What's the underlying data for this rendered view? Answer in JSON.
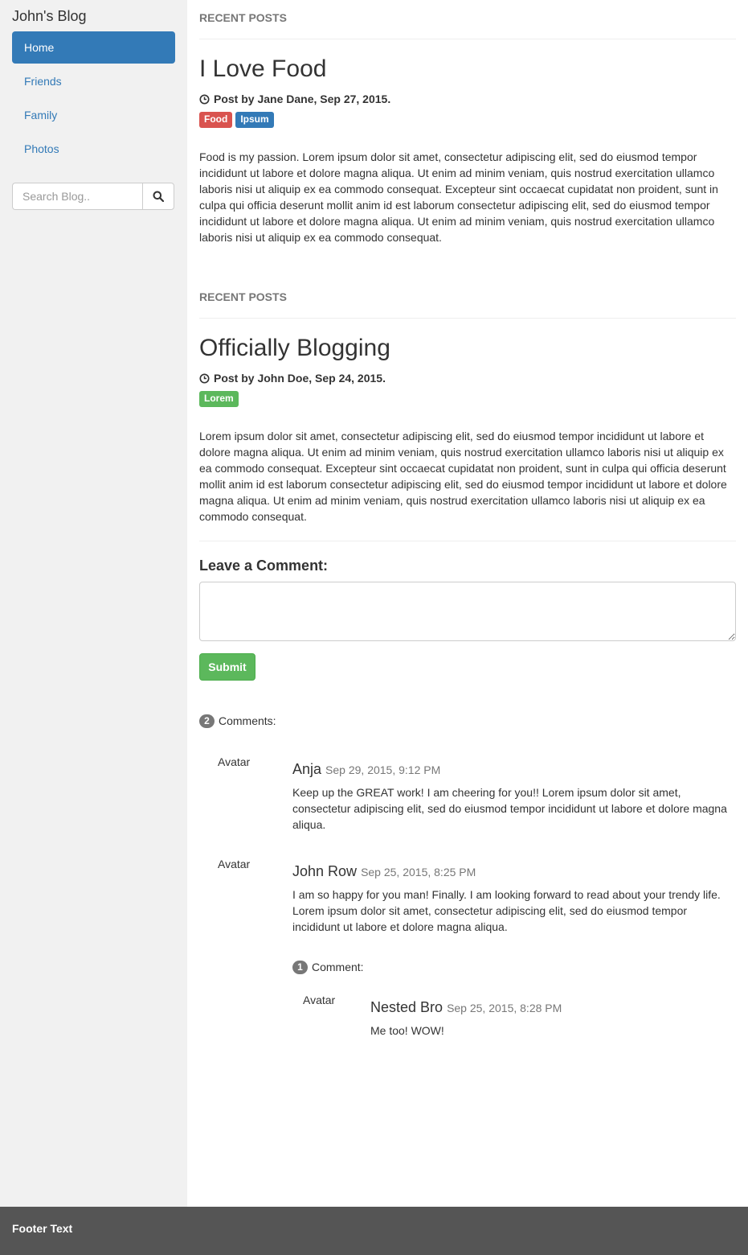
{
  "sidebar": {
    "brand": "John's Blog",
    "nav": [
      {
        "label": "Home",
        "active": true
      },
      {
        "label": "Friends",
        "active": false
      },
      {
        "label": "Family",
        "active": false
      },
      {
        "label": "Photos",
        "active": false
      }
    ],
    "search": {
      "placeholder": "Search Blog..",
      "icon": "search-icon"
    }
  },
  "posts": [
    {
      "section_label": "RECENT POSTS",
      "title": "I Love Food",
      "meta": "Post by Jane Dane, Sep 27, 2015.",
      "labels": [
        {
          "text": "Food",
          "color": "#d9534f"
        },
        {
          "text": "Ipsum",
          "color": "#337ab7"
        }
      ],
      "body": "Food is my passion. Lorem ipsum dolor sit amet, consectetur adipiscing elit, sed do eiusmod tempor incididunt ut labore et dolore magna aliqua. Ut enim ad minim veniam, quis nostrud exercitation ullamco laboris nisi ut aliquip ex ea commodo consequat. Excepteur sint occaecat cupidatat non proident, sunt in culpa qui officia deserunt mollit anim id est laborum consectetur adipiscing elit, sed do eiusmod tempor incididunt ut labore et dolore magna aliqua. Ut enim ad minim veniam, quis nostrud exercitation ullamco laboris nisi ut aliquip ex ea commodo consequat."
    },
    {
      "section_label": "RECENT POSTS",
      "title": "Officially Blogging",
      "meta": "Post by John Doe, Sep 24, 2015.",
      "labels": [
        {
          "text": "Lorem",
          "color": "#5cb85c"
        }
      ],
      "body": "Lorem ipsum dolor sit amet, consectetur adipiscing elit, sed do eiusmod tempor incididunt ut labore et dolore magna aliqua. Ut enim ad minim veniam, quis nostrud exercitation ullamco laboris nisi ut aliquip ex ea commodo consequat. Excepteur sint occaecat cupidatat non proident, sunt in culpa qui officia deserunt mollit anim id est laborum consectetur adipiscing elit, sed do eiusmod tempor incididunt ut labore et dolore magna aliqua. Ut enim ad minim veniam, quis nostrud exercitation ullamco laboris nisi ut aliquip ex ea commodo consequat."
    }
  ],
  "comment_form": {
    "heading": "Leave a Comment:",
    "textarea_value": "",
    "submit_label": "Submit"
  },
  "comments": {
    "count": "2",
    "count_label": "Comments:",
    "items": [
      {
        "avatar": "Avatar",
        "author": "Anja",
        "time": "Sep 29, 2015, 9:12 PM",
        "text": "Keep up the GREAT work! I am cheering for you!! Lorem ipsum dolor sit amet, consectetur adipiscing elit, sed do eiusmod tempor incididunt ut labore et dolore magna aliqua."
      },
      {
        "avatar": "Avatar",
        "author": "John Row",
        "time": "Sep 25, 2015, 8:25 PM",
        "text": "I am so happy for you man! Finally. I am looking forward to read about your trendy life. Lorem ipsum dolor sit amet, consectetur adipiscing elit, sed do eiusmod tempor incididunt ut labore et dolore magna aliqua.",
        "replies": {
          "count": "1",
          "count_label": "Comment:",
          "items": [
            {
              "avatar": "Avatar",
              "author": "Nested Bro",
              "time": "Sep 25, 2015, 8:28 PM",
              "text": "Me too! WOW!"
            }
          ]
        }
      }
    ]
  },
  "footer": {
    "text": "Footer Text"
  },
  "colors": {
    "primary": "#337ab7",
    "success": "#5cb85c",
    "danger": "#d9534f",
    "sidebar_bg": "#f1f1f1",
    "footer_bg": "#555555"
  }
}
